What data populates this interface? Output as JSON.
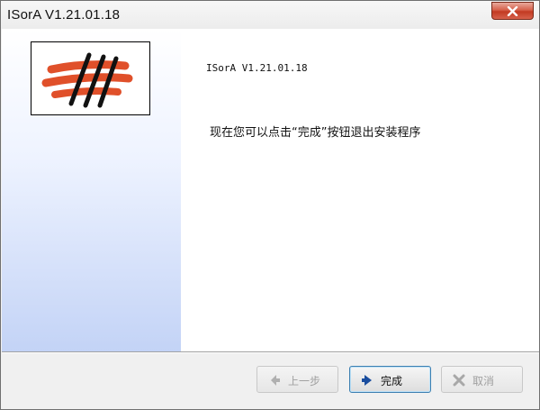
{
  "window": {
    "title": "ISorA V1.21.01.18",
    "close_icon": "close-icon"
  },
  "main": {
    "version": "ISorA V1.21.01.18",
    "message": "现在您可以点击“完成”按钮退出安装程序"
  },
  "buttons": {
    "back": {
      "label": "上一步",
      "icon": "left-arrow-icon",
      "enabled": false
    },
    "finish": {
      "label": "完成",
      "icon": "right-arrow-icon",
      "enabled": true
    },
    "cancel": {
      "label": "取消",
      "icon": "x-icon",
      "enabled": false
    }
  },
  "colors": {
    "logo_stripe": "#e0502a",
    "close_button": "#c94a33",
    "finish_arrow": "#1a4d9e"
  }
}
